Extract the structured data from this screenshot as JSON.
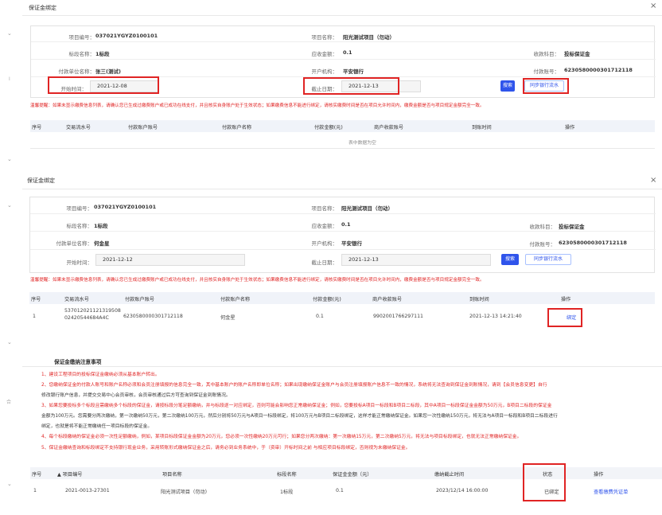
{
  "panel1": {
    "title": "保证金绑定",
    "close": "×",
    "labels": {
      "project_no": "项目编号：",
      "project_name": "项目名称：",
      "lot_name": "标段名称：",
      "due_amount": "应收金额：",
      "receive_subject": "收款科目：",
      "payer_name": "付款单位名称：",
      "bank": "开户机构：",
      "payer_account": "付款账号：",
      "start_time": "开始时间：",
      "end_date": "截止日期："
    },
    "values": {
      "project_no": "037021YGYZ0100101",
      "project_name": "阳光测试项目（勿动）",
      "lot_name": "1标段",
      "due_amount": "0.1",
      "receive_subject": "投标保证金",
      "payer_name": "张三(测试)",
      "bank": "平安银行",
      "payer_account": "6230580000301712118",
      "start_time": "2021-12-08",
      "end_date": "2021-12-13"
    },
    "search_btn": "搜索",
    "sync_btn": "同步银行流水",
    "warning": "温馨提醒：如果未显示缴费信息列表，请确认您已生成过缴费账户或已成功在线支付，并且核实自身账户处于生效状态；如果缴费信息不能进行绑定，请核实缴费时间是否在项目允许时间内，缴费金额是否与项目规定金额完全一致。",
    "table": {
      "headers": [
        "序号",
        "交易流水号",
        "付款账户账号",
        "付款账户名称",
        "付款金额(元)",
        "商户收款账号",
        "到账时间",
        "操作"
      ],
      "empty": "表中数据为空"
    }
  },
  "panel2": {
    "title": "保证金绑定",
    "close": "×",
    "labels": {
      "project_no": "项目编号：",
      "project_name": "项目名称：",
      "lot_name": "标段名称：",
      "due_amount": "应收金额：",
      "receive_subject": "收款科目：",
      "payer_name": "付款单位名称：",
      "bank": "开户机构：",
      "payer_account": "付款账号：",
      "start_time": "开始时间：",
      "end_date": "截止日期："
    },
    "values": {
      "project_no": "037021YGYZ0100101",
      "project_name": "阳光测试项目（勿动）",
      "lot_name": "1标段",
      "due_amount": "0.1",
      "receive_subject": "投标保证金",
      "payer_name": "何金星",
      "bank": "平安银行",
      "payer_account": "6230580000301712118",
      "start_time": "2021-12-12",
      "end_date": "2021-12-13"
    },
    "search_btn": "搜索",
    "sync_btn": "同步银行流水",
    "warning": "温馨提醒：如果未显示缴费信息列表，请确认您已生成过缴费账户或已成功在线支付，并且核实自身账户处于生效状态；如果缴费信息不能进行绑定，请核实缴费时间是否在项目允许时间内，缴费金额是否与项目规定金额完全一致。",
    "table": {
      "headers": [
        "序号",
        "交易流水号",
        "付款账户账号",
        "付款账户名称",
        "付款金额(元)",
        "商户收款账号",
        "到账时间",
        "操作"
      ],
      "row": {
        "no": "1",
        "serial_line1": "537012021121319508",
        "serial_line2": "02420544684A4C",
        "account": "6230580000301712118",
        "account_name": "何金星",
        "amount": "0.1",
        "merchant_account": "9902001766297111",
        "arrival_time": "2021-12-13 14:21:40",
        "action": "绑定"
      }
    }
  },
  "panel3": {
    "notes_title": "保证金缴纳注意事项",
    "notes": [
      "1、建设工程项目的投标保证金缴纳必须从基本账户转出。",
      "2、您缴纳保证金的付款人账号和账户名称必须和会员注册填报的信息完全一致，其中基本账户的账户名称即单位名称；如果出现缴纳保证金账户与会员注册填报账户信息不一致的情况，系统将无法查询到保证金到账情况，请到【会员信息变更】自行",
      "修改银行账户信息，并提交交易中心会员审核，会员审核通过后方可查询到保证金到账情况。",
      "3、如果您要投标多个标段且需缴纳多个标段的保证金，请按标段分笔足额缴纳，并与标段逐一对应绑定，否则可能会影响您正常缴纳保证金；例如，您要投标A项目一标段和B项目二标段，其中A项目一标段保证金金额为50万元，B项目二标段的保证金",
      "金额为100万元。您需要分两次缴纳，第一次缴纳50万元，第二次缴纳100万元，然后分别将50万元与A项目一标段绑定，将100万元与B项目二标段绑定，这样才能正常缴纳保证金。如果您一次性缴纳150万元，将无法与A项目一标段和B项目二标段进行",
      "绑定，也就是将不能正常缴纳任一项目标段的保证金。",
      "4、每个标段缴纳的保证金必须一次性足额缴纳，例如，某项目标段保证金金额为20万元，您必须一次性缴纳20万元可行；如果您分两次缴纳：第一次缴纳15万元，第二次缴纳5万元，将无法与项目标段绑定，也就无法正常缴纳保证金。",
      "5、保证金缴纳查询和标段绑定不支持银行现金业务，采用转账形式缴纳保证金之后，请务必到业务系统中，于（资审）开标时间之前 与相应项目标段绑定，否则视为未缴纳保证金。"
    ],
    "table": {
      "headers": [
        "序号",
        "▲ 项目编号",
        "项目名称",
        "标段名称",
        "保证金金额（元）",
        "缴纳截止时间",
        "状态",
        "操作"
      ],
      "row": {
        "no": "1",
        "project_no": "2021-0013-27301",
        "project_name": "阳光测试项目（勿动）",
        "lot_name": "1标段",
        "amount": "0.1",
        "deadline": "2023/12/14 16:00:00",
        "status": "已绑定",
        "action": "查看缴费凭证单"
      }
    }
  },
  "gutter": {
    "chev": "⌄",
    "side_char_1": "I",
    "side_char_2": "合"
  },
  "colors": {
    "accent": "#2f54eb",
    "alert": "#e02424",
    "header_bg": "#f0f3f9"
  }
}
